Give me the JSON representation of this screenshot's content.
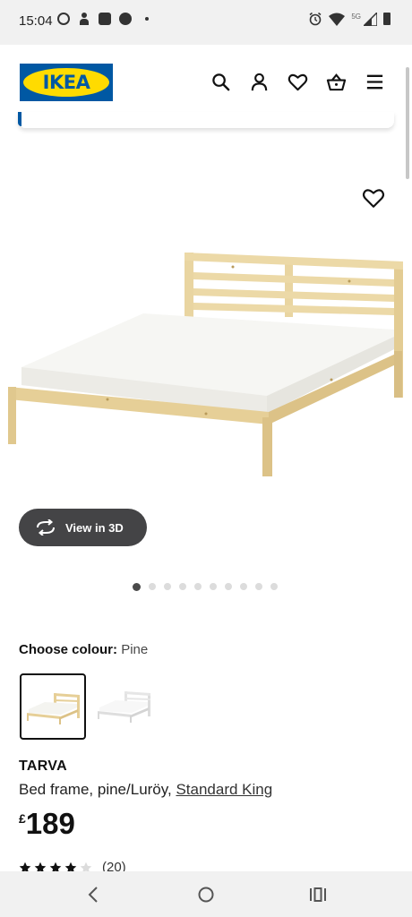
{
  "status_bar": {
    "time": "15:04",
    "left_icons": [
      "whatsapp-icon",
      "person-icon",
      "app-icon",
      "motorola-icon",
      "dot-icon"
    ],
    "network_label": "5G",
    "right_icons": [
      "alarm-icon",
      "wifi-icon",
      "signal-icon",
      "battery-icon"
    ]
  },
  "header": {
    "logo_text": "IKEA",
    "icons": [
      "search-icon",
      "account-icon",
      "heart-icon",
      "basket-icon",
      "menu-icon"
    ],
    "brand_colors": {
      "blue": "#0058a3",
      "yellow": "#ffdb00"
    }
  },
  "gallery": {
    "view_3d_label": "View in 3D",
    "dot_count": 10,
    "active_dot": 1
  },
  "colour": {
    "label": "Choose colour:",
    "selected": "Pine",
    "swatches": [
      "pine",
      "white"
    ]
  },
  "product": {
    "name": "TARVA",
    "description": "Bed frame, pine/Luröy, ",
    "size_link": "Standard King",
    "currency": "£",
    "price": "189",
    "rating_stars": 4,
    "rating_count": "(20)"
  },
  "nav_bar": {
    "buttons": [
      "back-icon",
      "home-icon",
      "recents-icon"
    ]
  }
}
